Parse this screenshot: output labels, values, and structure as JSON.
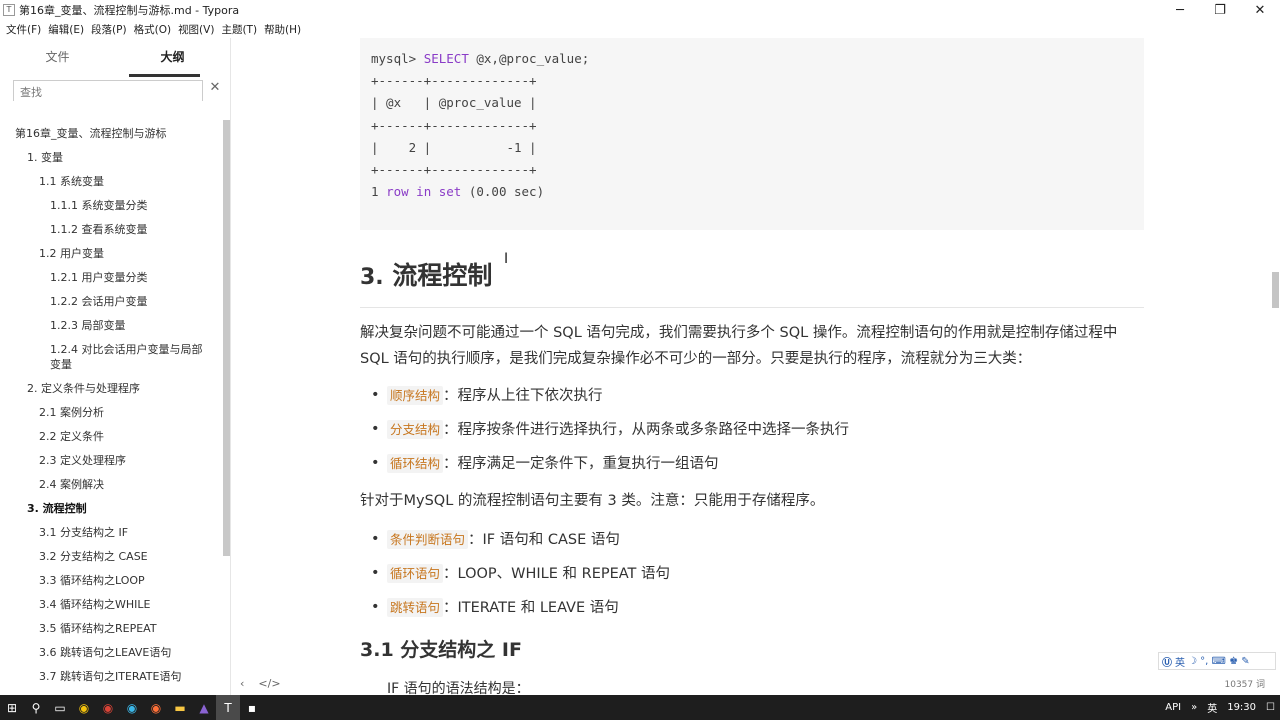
{
  "window": {
    "title": "第16章_变量、流程控制与游标.md - Typora",
    "app_icon": "T",
    "minimize": "─",
    "maximize": "❐",
    "close": "✕"
  },
  "menu": [
    "文件(F)",
    "编辑(E)",
    "段落(P)",
    "格式(O)",
    "视图(V)",
    "主题(T)",
    "帮助(H)"
  ],
  "sidebar": {
    "tab_files": "文件",
    "tab_outline": "大纲",
    "search_placeholder": "查找",
    "search_close": "✕",
    "outline": [
      {
        "label": "第16章_变量、流程控制与游标",
        "level": 1
      },
      {
        "label": "1. 变量",
        "level": 2
      },
      {
        "label": "1.1 系统变量",
        "level": 3
      },
      {
        "label": "1.1.1 系统变量分类",
        "level": 4
      },
      {
        "label": "1.1.2 查看系统变量",
        "level": 4
      },
      {
        "label": "1.2 用户变量",
        "level": 3
      },
      {
        "label": "1.2.1 用户变量分类",
        "level": 4
      },
      {
        "label": "1.2.2 会话用户变量",
        "level": 4
      },
      {
        "label": "1.2.3 局部变量",
        "level": 4
      },
      {
        "label": "1.2.4 对比会话用户变量与局部变量",
        "level": 4
      },
      {
        "label": "2. 定义条件与处理程序",
        "level": 2
      },
      {
        "label": "2.1 案例分析",
        "level": 3
      },
      {
        "label": "2.2 定义条件",
        "level": 3
      },
      {
        "label": "2.3 定义处理程序",
        "level": 3
      },
      {
        "label": "2.4 案例解决",
        "level": 3
      },
      {
        "label": "3. 流程控制",
        "level": 2,
        "active": true
      },
      {
        "label": "3.1 分支结构之 IF",
        "level": 3
      },
      {
        "label": "3.2 分支结构之 CASE",
        "level": 3
      },
      {
        "label": "3.3 循环结构之LOOP",
        "level": 3
      },
      {
        "label": "3.4 循环结构之WHILE",
        "level": 3
      },
      {
        "label": "3.5 循环结构之REPEAT",
        "level": 3
      },
      {
        "label": "3.6 跳转语句之LEAVE语句",
        "level": 3
      },
      {
        "label": "3.7 跳转语句之ITERATE语句",
        "level": 3
      }
    ],
    "footer_back": "‹",
    "footer_code": "</>"
  },
  "content": {
    "code_lines": [
      {
        "prefix": "mysql> ",
        "kw": "SELECT",
        "rest": " @x,@proc_value;"
      },
      {
        "prefix": "+------+-------------+",
        "kw": "",
        "rest": ""
      },
      {
        "prefix": "| @x   | @proc_value |",
        "kw": "",
        "rest": ""
      },
      {
        "prefix": "+------+-------------+",
        "kw": "",
        "rest": ""
      },
      {
        "prefix": "|    2 |          -1 |",
        "kw": "",
        "rest": ""
      },
      {
        "prefix": "+------+-------------+",
        "kw": "",
        "rest": ""
      },
      {
        "prefix": "1 ",
        "kw": "row in set",
        "rest": " (0.00 sec)"
      }
    ],
    "h2_num": "3.",
    "h2_text": "流程控制",
    "intro": "解决复杂问题不可能通过一个 SQL 语句完成，我们需要执行多个 SQL 操作。流程控制语句的作用就是控制存储过程中 SQL 语句的执行顺序，是我们完成复杂操作必不可少的一部分。只要是执行的程序，流程就分为三大类：",
    "structures": [
      {
        "code": "顺序结构",
        "text": "：程序从上往下依次执行"
      },
      {
        "code": "分支结构",
        "text": "：程序按条件进行选择执行，从两条或多条路径中选择一条执行"
      },
      {
        "code": "循环结构",
        "text": "：程序满足一定条件下，重复执行一组语句"
      }
    ],
    "mysql_note": "针对于MySQL 的流程控制语句主要有 3 类。注意：只能用于存储程序。",
    "statements": [
      {
        "code": "条件判断语句",
        "text": "：IF 语句和 CASE 语句"
      },
      {
        "code": "循环语句",
        "text": "：LOOP、WHILE 和 REPEAT 语句"
      },
      {
        "code": "跳转语句",
        "text": "：ITERATE 和 LEAVE 语句"
      }
    ],
    "h3": "3.1 分支结构之 IF",
    "cut_text": "IF 语句的语法结构是："
  },
  "status": {
    "word_count": "10357 词"
  },
  "ime": {
    "label": "英",
    "icons": "☽ °, ⌨ ♚ ✎"
  },
  "taskbar": {
    "start": "⊞",
    "search": "⚲",
    "apps": [
      "▭",
      "◉",
      "◉",
      "◉",
      "◉",
      "▬",
      "▲",
      "T",
      "▪"
    ],
    "tray_api": "API",
    "tray_arrow": "»",
    "lang": "英",
    "time": "19:30",
    "notify": "☐"
  }
}
